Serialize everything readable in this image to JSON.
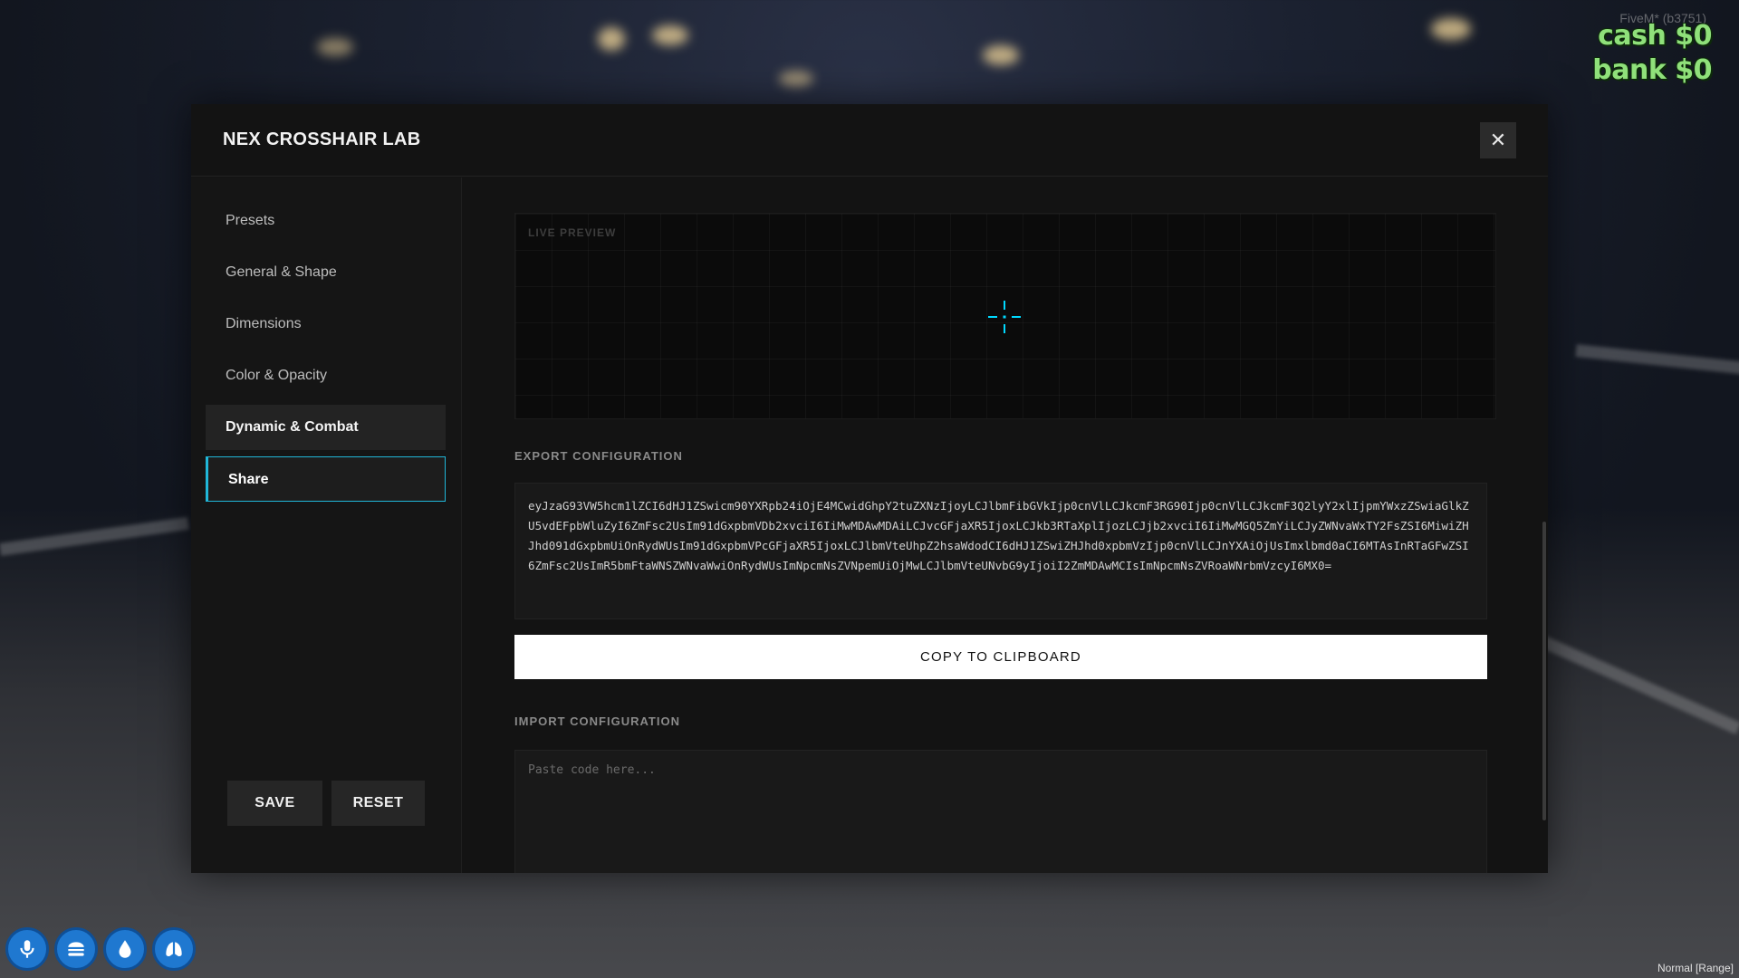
{
  "hud": {
    "server": "FiveM* (b3751)",
    "cash": "cash $0",
    "bank": "bank $0",
    "mode": "Normal [Range]",
    "status_icons": [
      "microphone-icon",
      "burger-icon",
      "water-drop-icon",
      "lungs-icon"
    ]
  },
  "modal": {
    "title": "NEX CROSSHAIR LAB",
    "close_label": "✕"
  },
  "sidebar": {
    "items": [
      {
        "label": "Presets"
      },
      {
        "label": "General & Shape"
      },
      {
        "label": "Dimensions"
      },
      {
        "label": "Color & Opacity"
      },
      {
        "label": "Dynamic & Combat"
      },
      {
        "label": "Share"
      }
    ],
    "active_item": "Share",
    "save_label": "SAVE",
    "reset_label": "RESET"
  },
  "content": {
    "preview_label": "LIVE PREVIEW",
    "export_label": "EXPORT CONFIGURATION",
    "export_code": "eyJzaG93VW5hcm1lZCI6dHJ1ZSwicm90YXRpb24iOjE4MCwidGhpY2tuZXNzIjoyLCJlbmFibGVkIjp0cnVlLCJkcmF3RG90Ijp0cnVlLCJkcmF3Q2lyY2xlIjpmYWxzZSwiaGlkZU5vdEFpbWluZyI6ZmFsc2UsIm91dGxpbmVDb2xvciI6IiMwMDAwMDAiLCJvcGFjaXR5IjoxLCJkb3RTaXplIjozLCJjb2xvciI6IiMwMGQ5ZmYiLCJyZWNvaWxTY2FsZSI6MiwiZHJhd091dGxpbmUiOnRydWUsIm91dGxpbmVPcGFjaXR5IjoxLCJlbmVteUhpZ2hsaWdodCI6dHJ1ZSwiZHJhd0xpbmVzIjp0cnVlLCJnYXAiOjUsImxlbmd0aCI6MTAsInRTaGFwZSI6ZmFsc2UsImR5bmFtaWNSZWNvaWwiOnRydWUsImNpcmNsZVNpemUiOjMwLCJlbmVteUNvbG9yIjoiI2ZmMDAwMCIsImNpcmNsZVRoaWNrbmVzcyI6MX0=",
    "copy_label": "COPY TO CLIPBOARD",
    "import_label": "IMPORT CONFIGURATION",
    "import_placeholder": "Paste code here...",
    "import_value": ""
  },
  "colors": {
    "accent": "#20b6d8",
    "crosshair": "#00d9ff",
    "money": "#8fe07a",
    "status_blue": "#1f78d0"
  }
}
